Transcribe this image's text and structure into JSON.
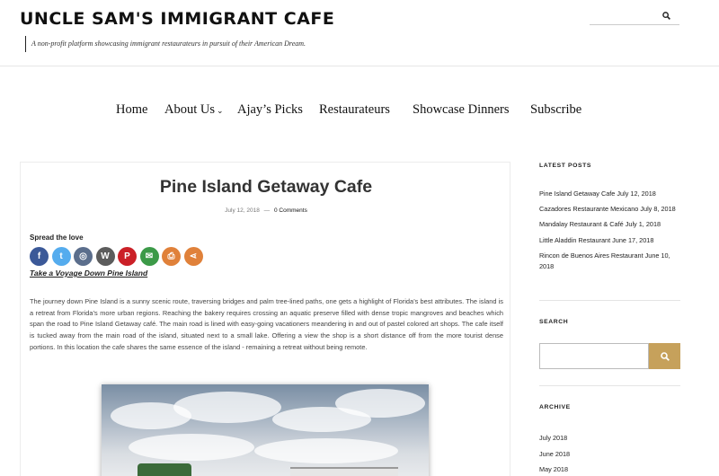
{
  "site": {
    "title": "UNCLE SAM'S IMMIGRANT CAFE",
    "tagline": "A non-profit platform showcasing immigrant restaurateurs in pursuit of their American Dream."
  },
  "nav": {
    "home": "Home",
    "about": "About Us",
    "picks": "Ajay’s Picks",
    "restaurateurs": "Restaurateurs",
    "dinners": "Showcase Dinners",
    "subscribe": "Subscribe"
  },
  "post": {
    "title": "Pine Island Getaway Cafe",
    "date": "July 12, 2018",
    "separator": "—",
    "comments": "0 Comments",
    "spread_label": "Spread the love",
    "subheading": "Take a Voyage Down Pine Island",
    "paragraph": "The journey down Pine Island is a sunny scenic route, traversing bridges and palm tree-lined paths, one gets a highlight of Florida’s best attributes. The island is a retreat from Florida’s more urban regions. Reaching the bakery requires crossing an aquatic preserve filled with dense tropic mangroves and beaches which span the road to Pine Island Getaway café. The main road is lined with easy-going vacationers meandering in and out of pastel colored art shops. The cafe itself is tucked away from the main road of the island, situated next to a small lake. Offering a view the shop is a short distance off from the more tourist dense portions. In this location the cafe shares the same essence of the island - remaining a retreat without being remote."
  },
  "share_buttons": [
    {
      "icon": "facebook-icon",
      "glyph": "f",
      "color": "#3b5998"
    },
    {
      "icon": "twitter-icon",
      "glyph": "t",
      "color": "#55acee"
    },
    {
      "icon": "instagram-icon",
      "glyph": "◎",
      "color": "#5b6e8c"
    },
    {
      "icon": "wordpress-icon",
      "glyph": "W",
      "color": "#5c5c5c"
    },
    {
      "icon": "pinterest-icon",
      "glyph": "P",
      "color": "#cb2027"
    },
    {
      "icon": "email-icon",
      "glyph": "✉",
      "color": "#3c9a48"
    },
    {
      "icon": "print-icon",
      "glyph": "⎙",
      "color": "#e0813a"
    },
    {
      "icon": "more-share-icon",
      "glyph": "⋖",
      "color": "#e0813a"
    }
  ],
  "sidebar": {
    "latest_heading": "LATEST POSTS",
    "posts": [
      {
        "title": "Pine Island Getaway Cafe",
        "date": "July 12, 2018"
      },
      {
        "title": "Cazadores Restaurante Mexicano",
        "date": "July 8, 2018"
      },
      {
        "title": "Mandalay Restaurant & Café",
        "date": "July 1, 2018"
      },
      {
        "title": "Little Aladdin Restaurant",
        "date": "June 17, 2018"
      },
      {
        "title": "Rincon de Buenos Aires Restaurant",
        "date": "June 10, 2018"
      }
    ],
    "search_heading": "SEARCH",
    "archive_heading": "ARCHIVE",
    "archive": [
      "July 2018",
      "June 2018",
      "May 2018"
    ]
  },
  "colors": {
    "accent": "#c6a15b"
  }
}
